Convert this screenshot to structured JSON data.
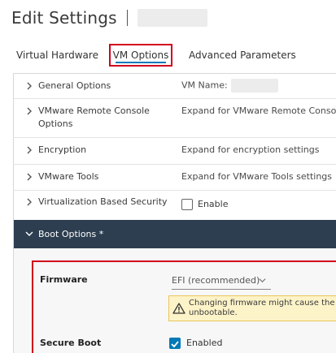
{
  "header": {
    "title": "Edit Settings"
  },
  "tabs": [
    {
      "label": "Virtual Hardware"
    },
    {
      "label": "VM Options"
    },
    {
      "label": "Advanced Parameters"
    }
  ],
  "sections": [
    {
      "label": "General Options",
      "value": "VM Name:"
    },
    {
      "label": "VMware Remote Console Options",
      "value": "Expand for VMware Remote Console"
    },
    {
      "label": "Encryption",
      "value": "Expand for encryption settings"
    },
    {
      "label": "VMware Tools",
      "value": "Expand for VMware Tools settings"
    },
    {
      "label": "Virtualization Based Security",
      "checkbox_label": "Enable"
    }
  ],
  "boot": {
    "header": "Boot Options *",
    "firmware_label": "Firmware",
    "firmware_value": "EFI (recommended)",
    "warning_line1": "Changing firmware might cause the installe",
    "warning_line2": "unbootable.",
    "secure_boot_label": "Secure Boot",
    "secure_boot_value": "Enabled"
  },
  "colors": {
    "accent": "#0079b8",
    "highlight": "#d0021b",
    "header_bg": "#2c3e50",
    "warning_bg": "#fdf3c8"
  }
}
